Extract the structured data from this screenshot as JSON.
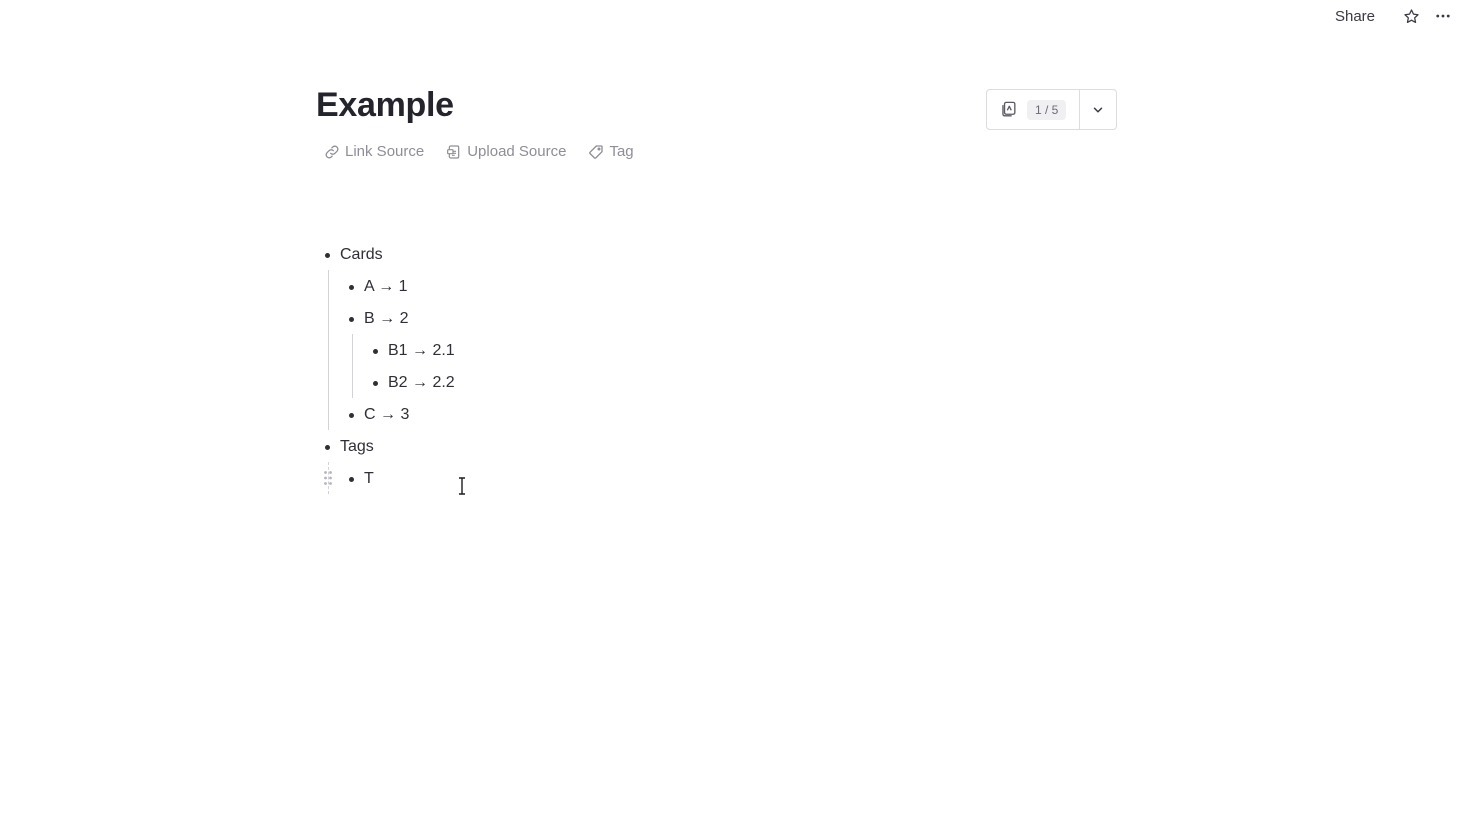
{
  "topbar": {
    "share_label": "Share",
    "star_icon": "star-icon",
    "more_icon": "more-horizontal-icon"
  },
  "page": {
    "title": "Example"
  },
  "meta": {
    "link_source_label": "Link Source",
    "upload_source_label": "Upload Source",
    "tag_label": "Tag"
  },
  "card_widget": {
    "icon": "cards-icon",
    "counter": "1 / 5",
    "dropdown_icon": "chevron-down-icon"
  },
  "outline": {
    "cards": "Cards",
    "a": "A → 1",
    "b": "B → 2",
    "b1": "B1 → 2.1",
    "b2": "B2 → 2.2",
    "c": "C → 3",
    "tags": "Tags",
    "t": "T"
  },
  "colors": {
    "text": "#2f2f37",
    "muted": "#8e8e97",
    "border": "#dcdce2"
  }
}
